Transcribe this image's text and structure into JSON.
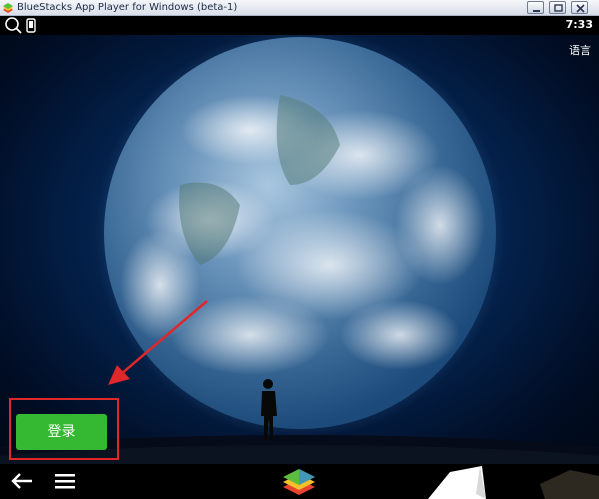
{
  "window": {
    "title": "BlueStacks App Player for Windows (beta-1)",
    "controls": [
      "minimize",
      "maximize",
      "close"
    ]
  },
  "statusbar": {
    "time": "7:33",
    "icons": [
      "search-icon",
      "phone-icon"
    ]
  },
  "app": {
    "language_label": "语言",
    "login_label": "登录",
    "login_color": "#35b932",
    "highlight_color": "#e0272a",
    "background_scene": [
      "earth-image",
      "standing-figure"
    ]
  },
  "navbar": {
    "icons": [
      "back-icon",
      "menu-icon",
      "bluestacks-home-icon"
    ]
  }
}
